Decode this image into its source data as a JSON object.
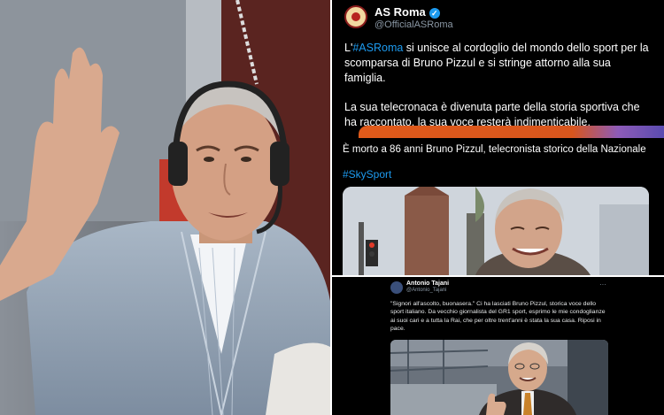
{
  "tweet_roma": {
    "name": "AS Roma",
    "handle": "@OfficialASRoma",
    "para1_tag": "#ASRoma",
    "para1_prefix": "L'",
    "para1_rest": " si unisce al cordoglio del mondo dello sport per la scomparsa di Bruno Pizzul e si stringe attorno alla sua famiglia.",
    "para2": "La sua telecronaca è divenuta parte della storia sportiva che ha raccontato, la sua voce resterà indimenticabile."
  },
  "tweet_sky": {
    "title": "È morto a 86 anni Bruno Pizzul, telecronista storico della Nazionale",
    "hashtag": "#SkySport"
  },
  "tweet_tajani": {
    "name": "Antonio Tajani",
    "handle": "@Antonio_Tajani",
    "more": "···",
    "text": "\"Signori all'ascolto, buonasera.\" Ci ha lasciati Bruno Pizzul, storica voce dello sport italiano. Da vecchio giornalista del GR1 sport, esprimo le mie condoglianze ai suoi cari e a tutta la Rai, che per oltre trent'anni è stata la sua casa. Riposi in pace."
  },
  "colors": {
    "twitter_blue": "#1d9bf0",
    "roma_red": "#8a1c1c",
    "background": "#000000"
  },
  "icons": [
    "verified-badge-icon",
    "more-options-icon"
  ]
}
